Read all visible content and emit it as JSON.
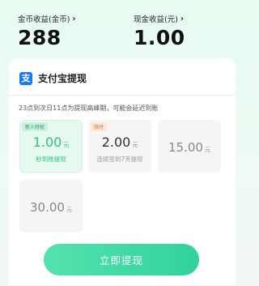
{
  "header": {
    "coin_label": "金币收益(金币)",
    "coin_value": "288",
    "cash_label": "现金收益(元)",
    "cash_value": "1.00"
  },
  "withdraw": {
    "title": "支付宝提现",
    "notice": "23点到次日11点为提现高峰期，可能会延迟到账",
    "options": [
      {
        "tag": "新人特权",
        "amount": "1.00",
        "unit": "元",
        "desc": "秒到账提现",
        "selected": true
      },
      {
        "tag": "限时",
        "amount": "2.00",
        "unit": "元",
        "desc": "连续签到7天提现",
        "selected": false
      },
      {
        "amount": "15.00",
        "unit": "元",
        "selected": false
      },
      {
        "amount": "30.00",
        "unit": "元",
        "selected": false
      }
    ],
    "button_label": "立即提现"
  },
  "colors": {
    "accent": "#2fc08a",
    "alipay": "#1677ff"
  }
}
